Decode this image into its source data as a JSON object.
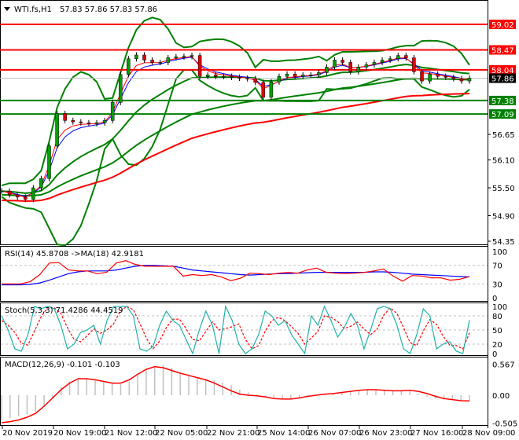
{
  "header": {
    "symbol": "WTI.fs,H1",
    "ohlc": "57.83 57.86 57.83 57.86"
  },
  "colors": {
    "bull": "#00a000",
    "bear": "#e00000",
    "level_res": "#ff0000",
    "level_sup": "#008000",
    "bollinger": "#008000",
    "slow_ma": "#ff0000",
    "rsi": "#ff0000",
    "rsi_ma": "#0000ff",
    "stoch_main": "#20b2aa",
    "stoch_signal": "#ff0000",
    "macd_hist": "#c0c0c0",
    "macd_signal": "#ff0000"
  },
  "chart_data": [
    {
      "type": "candlestick",
      "title": "WTI.fs,H1",
      "price_axis_ticks": [
        "56.65",
        "56.10",
        "55.50",
        "54.90",
        "54.35"
      ],
      "ylim": [
        54.35,
        59.02
      ],
      "current_price": {
        "label": "57.86",
        "value": 57.86
      },
      "levels": [
        {
          "label": "59.02",
          "value": 59.02,
          "kind": "resistance"
        },
        {
          "label": "58.47",
          "value": 58.47,
          "kind": "resistance"
        },
        {
          "label": "58.04",
          "value": 58.04,
          "kind": "resistance"
        },
        {
          "label": "57.38",
          "value": 57.38,
          "kind": "support"
        },
        {
          "label": "57.09",
          "value": 57.09,
          "kind": "support"
        }
      ],
      "closes": [
        55.43,
        55.35,
        55.3,
        55.25,
        55.5,
        55.7,
        56.4,
        57.1,
        56.95,
        56.92,
        56.9,
        56.88,
        56.9,
        56.95,
        57.34,
        57.94,
        58.28,
        58.36,
        58.25,
        58.2,
        58.2,
        58.3,
        58.32,
        58.33,
        58.35,
        57.9,
        57.93,
        57.9,
        57.9,
        57.88,
        57.86,
        57.85,
        57.77,
        57.45,
        57.78,
        57.9,
        57.95,
        57.9,
        57.93,
        57.93,
        57.98,
        58.1,
        58.25,
        58.2,
        58.0,
        58.1,
        58.15,
        58.2,
        58.25,
        58.28,
        58.35,
        58.3,
        58.0,
        57.8,
        57.95,
        57.9,
        57.88,
        57.85,
        57.8,
        57.86
      ],
      "x_tick_labels": [
        "20 Nov 2019",
        "20 Nov 19:00",
        "21 Nov 12:00",
        "22 Nov 05:00",
        "22 Nov 21:00",
        "25 Nov 14:00",
        "26 Nov 07:00",
        "26 Nov 23:00",
        "27 Nov 16:00",
        "28 Nov 09:00"
      ]
    },
    {
      "type": "line",
      "title": "RSI(14) 45.8708  ->MA(18) 42.9181",
      "ticks": [
        "100",
        "70",
        "30",
        "0"
      ],
      "levels": [
        70,
        30
      ],
      "ylim": [
        0,
        100
      ],
      "rsi": [
        30,
        30,
        30,
        35,
        50,
        75,
        76,
        60,
        58,
        58,
        52,
        55,
        75,
        80,
        72,
        68,
        68,
        68,
        68,
        47,
        50,
        48,
        50,
        45,
        37,
        42,
        53,
        52,
        50,
        53,
        55,
        53,
        60,
        64,
        55,
        53,
        52,
        53,
        55,
        58,
        62,
        47,
        36,
        48,
        47,
        43,
        43,
        38,
        40,
        46
      ],
      "ma": [
        28,
        28,
        28,
        29,
        32,
        38,
        45,
        52,
        56,
        58,
        58,
        58,
        60,
        64,
        68,
        70,
        70,
        69,
        68,
        64,
        60,
        58,
        56,
        54,
        52,
        50,
        49,
        50,
        51,
        52,
        52,
        53,
        54,
        55,
        55,
        55,
        55,
        55,
        55,
        56,
        56,
        55,
        53,
        51,
        50,
        49,
        48,
        47,
        46,
        45
      ]
    },
    {
      "type": "line",
      "title": "Stoch(5,3,3) 71.4286 44.4519",
      "ticks": [
        "100",
        "80",
        "50",
        "20",
        "0"
      ],
      "levels": [
        80,
        50,
        20
      ],
      "ylim": [
        0,
        100
      ],
      "main": [
        80,
        50,
        10,
        5,
        40,
        100,
        95,
        100,
        95,
        60,
        10,
        20,
        45,
        50,
        60,
        20,
        70,
        100,
        100,
        100,
        80,
        10,
        5,
        15,
        60,
        90,
        70,
        60,
        30,
        0,
        50,
        90,
        60,
        0,
        100,
        70,
        20,
        0,
        10,
        40,
        90,
        80,
        60,
        70,
        40,
        20,
        0,
        80,
        60,
        100,
        70,
        35,
        55,
        85,
        60,
        10,
        50,
        95,
        100,
        95,
        60,
        10,
        0,
        40,
        95,
        80,
        10,
        20,
        25,
        5,
        0,
        71
      ],
      "signal": [
        70,
        60,
        45,
        22,
        18,
        48,
        78,
        98,
        97,
        85,
        55,
        30,
        25,
        38,
        52,
        43,
        50,
        63,
        90,
        100,
        93,
        63,
        32,
        10,
        27,
        55,
        73,
        73,
        53,
        30,
        27,
        47,
        67,
        50,
        53,
        57,
        63,
        30,
        10,
        17,
        47,
        70,
        77,
        70,
        57,
        43,
        20,
        33,
        47,
        80,
        77,
        68,
        53,
        58,
        67,
        52,
        40,
        52,
        82,
        97,
        85,
        55,
        23,
        17,
        48,
        72,
        62,
        37,
        18,
        17,
        10,
        44
      ]
    },
    {
      "type": "bar+line",
      "title": "MACD(12,26,9) -0.101 -0.103",
      "ticks": [
        "0.567",
        "0.00",
        "-0.505"
      ],
      "ylim": [
        -0.505,
        0.567
      ],
      "histogram": [
        -0.45,
        -0.42,
        -0.38,
        -0.35,
        -0.3,
        -0.2,
        -0.05,
        0.15,
        0.25,
        0.3,
        0.3,
        0.27,
        0.25,
        0.22,
        0.2,
        0.25,
        0.35,
        0.45,
        0.52,
        0.55,
        0.5,
        0.42,
        0.38,
        0.33,
        0.3,
        0.27,
        0.23,
        0.18,
        0.1,
        0.05,
        0.0,
        -0.02,
        -0.04,
        -0.06,
        -0.07,
        -0.05,
        -0.02,
        0.0,
        0.02,
        0.03,
        0.05,
        0.07,
        0.09,
        0.1,
        0.09,
        0.08,
        0.08,
        0.08,
        0.07,
        0.03,
        -0.03,
        -0.06,
        -0.08,
        -0.09,
        -0.1,
        -0.101
      ],
      "signal": [
        -0.5,
        -0.48,
        -0.45,
        -0.4,
        -0.33,
        -0.2,
        -0.05,
        0.1,
        0.22,
        0.3,
        0.3,
        0.28,
        0.25,
        0.22,
        0.22,
        0.28,
        0.38,
        0.47,
        0.52,
        0.5,
        0.45,
        0.4,
        0.36,
        0.32,
        0.28,
        0.22,
        0.15,
        0.08,
        0.02,
        0.0,
        -0.01,
        -0.03,
        -0.06,
        -0.07,
        -0.07,
        -0.05,
        -0.02,
        0.0,
        0.02,
        0.03,
        0.05,
        0.07,
        0.09,
        0.1,
        0.1,
        0.09,
        0.08,
        0.08,
        0.09,
        0.07,
        0.03,
        -0.02,
        -0.06,
        -0.08,
        -0.1,
        -0.103
      ]
    }
  ]
}
